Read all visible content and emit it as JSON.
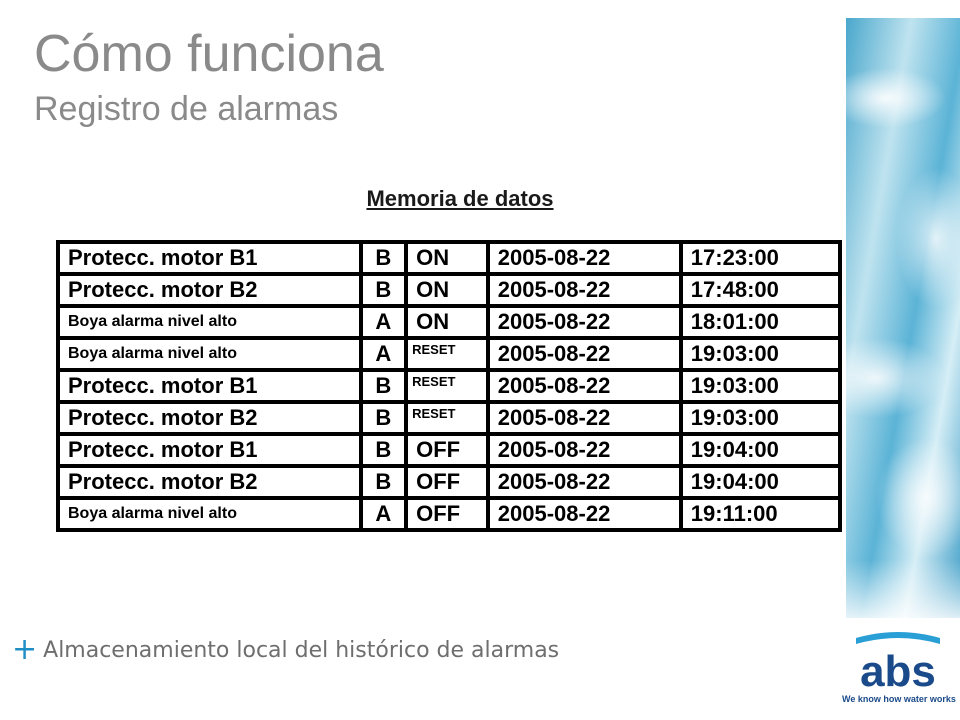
{
  "title": "Cómo funciona",
  "subtitle": "Registro de alarmas",
  "table_heading": "Memoria de datos",
  "rows": [
    {
      "name": "Protecc. motor B1",
      "code": "B",
      "state": "ON",
      "date": "2005-08-22",
      "time": "17:23:00"
    },
    {
      "name": "Protecc. motor B2",
      "code": "B",
      "state": "ON",
      "date": "2005-08-22",
      "time": "17:48:00"
    },
    {
      "name": "Boya alarma nivel alto",
      "code": "A",
      "state": "ON",
      "date": "2005-08-22",
      "time": "18:01:00"
    },
    {
      "name": "Boya alarma nivel alto",
      "code": "A",
      "state": "RESET",
      "date": "2005-08-22",
      "time": "19:03:00"
    },
    {
      "name": "Protecc. motor B1",
      "code": "B",
      "state": "RESET",
      "date": "2005-08-22",
      "time": "19:03:00"
    },
    {
      "name": "Protecc. motor B2",
      "code": "B",
      "state": "RESET",
      "date": "2005-08-22",
      "time": "19:03:00"
    },
    {
      "name": "Protecc. motor B1",
      "code": "B",
      "state": "OFF",
      "date": "2005-08-22",
      "time": "19:04:00"
    },
    {
      "name": "Protecc. motor B2",
      "code": "B",
      "state": "OFF",
      "date": "2005-08-22",
      "time": "19:04:00"
    },
    {
      "name": "Boya alarma nivel alto",
      "code": "A",
      "state": "OFF",
      "date": "2005-08-22",
      "time": "19:11:00"
    }
  ],
  "bullet": {
    "symbol": "+",
    "text": "Almacenamiento local del histórico de alarmas"
  },
  "logo": {
    "text": "abs",
    "tagline": "We know how water works",
    "color": "#1a4a8a"
  },
  "colors": {
    "title": "#8a8a8a",
    "accent": "#1f8ec4",
    "water": "#4aa7cc"
  }
}
